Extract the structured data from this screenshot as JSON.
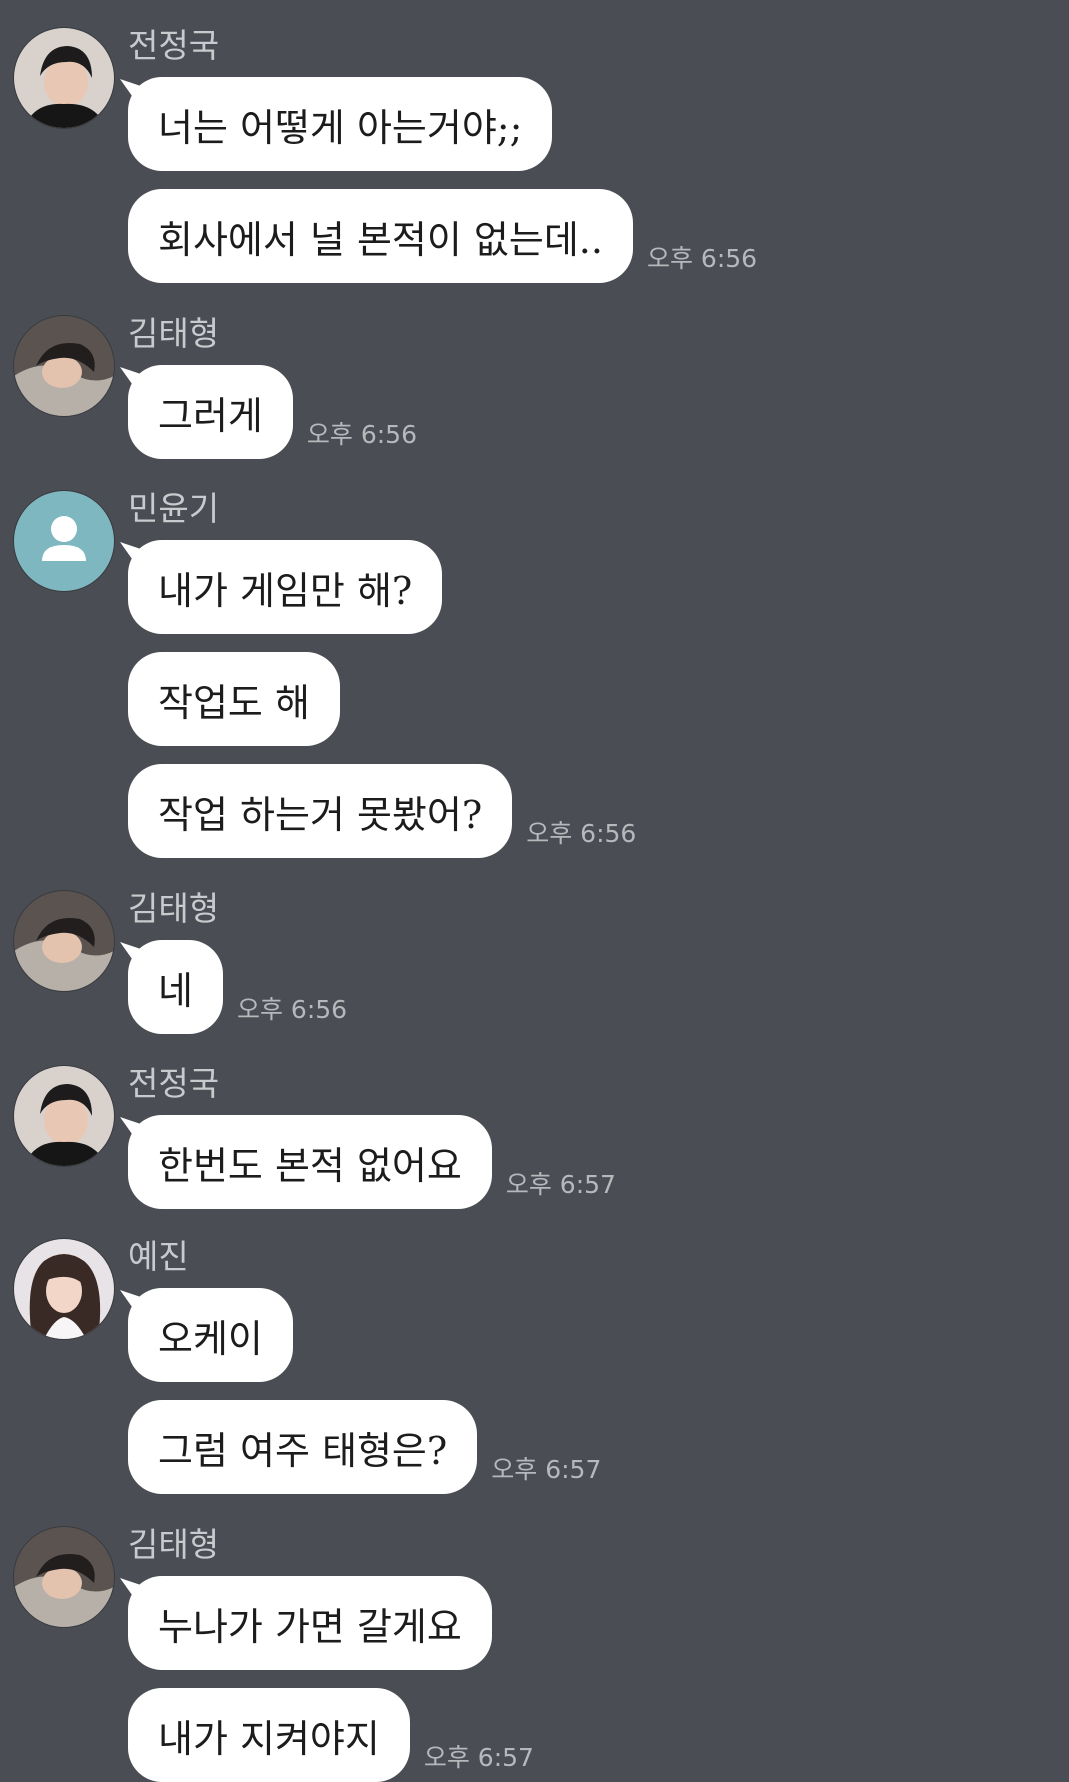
{
  "messages": [
    {
      "sender": "전정국",
      "avatar": "jungkook-photo",
      "bubbles": [
        "너는 어떻게 아는거야;;",
        "회사에서 널 본적이 없는데.."
      ],
      "time": "오후 6:56"
    },
    {
      "sender": "김태형",
      "avatar": "taehyung-photo",
      "bubbles": [
        "그러게"
      ],
      "time": "오후 6:56"
    },
    {
      "sender": "민윤기",
      "avatar": "default-profile-icon",
      "bubbles": [
        "내가 게임만 해?",
        "작업도 해",
        "작업 하는거 못봤어?"
      ],
      "time": "오후 6:56"
    },
    {
      "sender": "김태형",
      "avatar": "taehyung-photo",
      "bubbles": [
        "네"
      ],
      "time": "오후 6:56"
    },
    {
      "sender": "전정국",
      "avatar": "jungkook-photo",
      "bubbles": [
        "한번도 본적 없어요"
      ],
      "time": "오후 6:57"
    },
    {
      "sender": "예진",
      "avatar": "yejin-photo",
      "bubbles": [
        "오케이",
        "그럼 여주 태형은?"
      ],
      "time": "오후 6:57"
    },
    {
      "sender": "김태형",
      "avatar": "taehyung-photo",
      "bubbles": [
        "누나가 가면 갈게요",
        "내가 지켜야지"
      ],
      "time": "오후 6:57"
    }
  ],
  "colors": {
    "background": "#4a4d53",
    "bubble": "#ffffff",
    "sender_text": "#c9cacd",
    "time_text": "#b6b8bc",
    "default_avatar": "#7fb7c1"
  }
}
